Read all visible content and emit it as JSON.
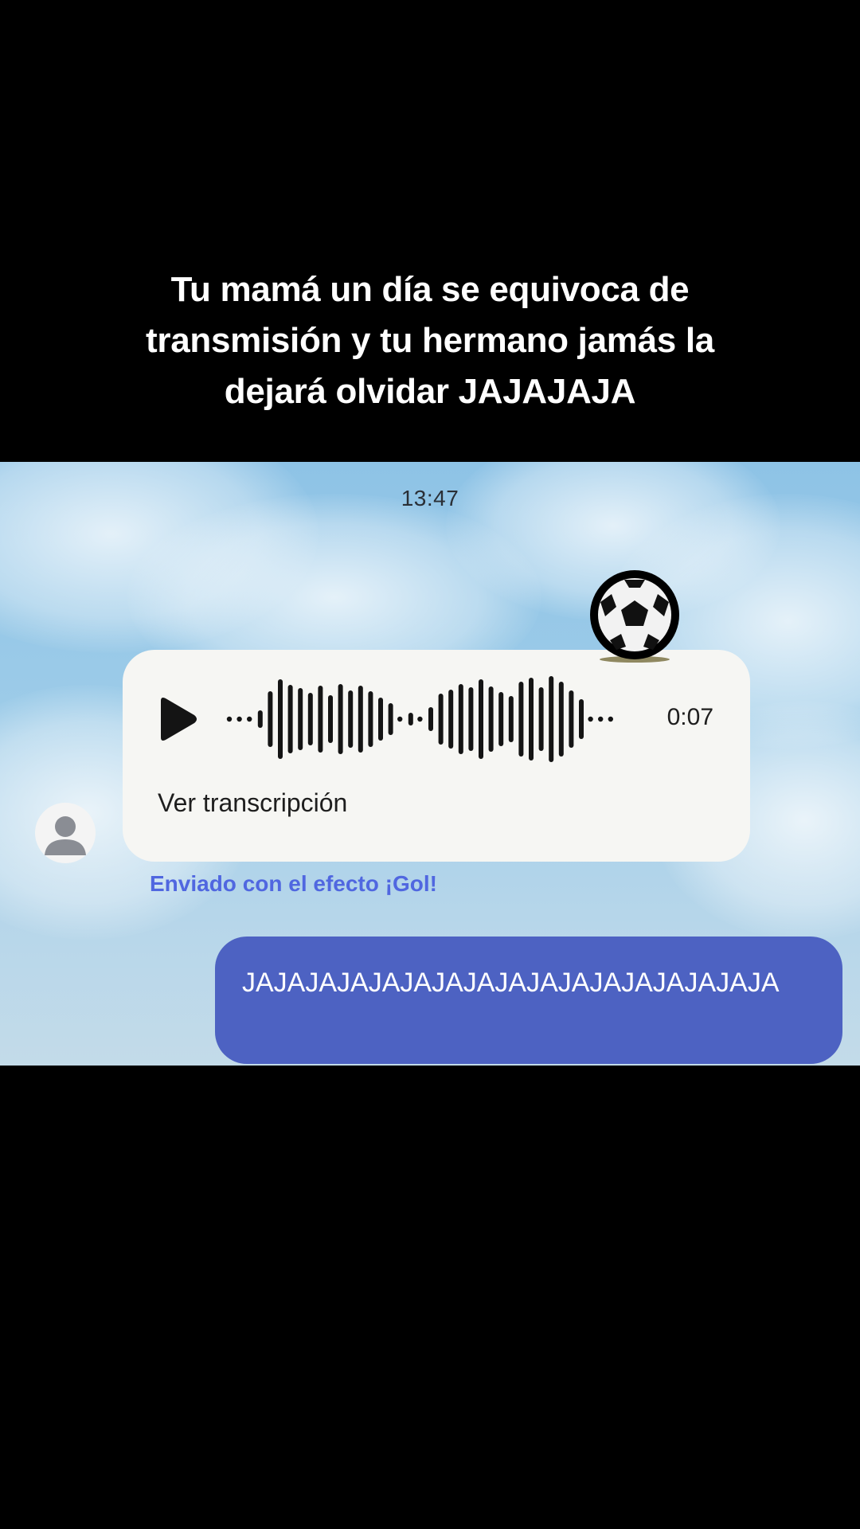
{
  "caption": {
    "text": "Tu mamá un día se equivoca de\ntransmisión y tu hermano jamás la\ndejará olvidar JAJAJAJA"
  },
  "chat": {
    "timestamp": "13:47",
    "voice_message": {
      "duration": "0:07",
      "transcript_link": "Ver transcripción",
      "effect_icon": "soccer-ball-icon",
      "play_icon": "play-icon"
    },
    "sent_effect_note": "Enviado con el efecto ¡Gol!",
    "outgoing_message": "JAJAJAJAJAJAJAJAJAJAJAJAJAJAJAJAJA"
  },
  "colors": {
    "background": "#000000",
    "incoming_bubble": "#f6f6f3",
    "outgoing_bubble": "#4d62c2",
    "effect_note": "#5067e0"
  }
}
